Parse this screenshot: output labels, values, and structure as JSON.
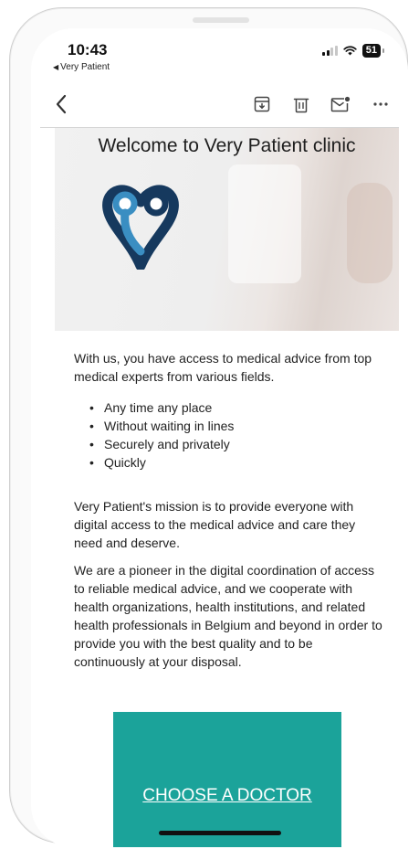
{
  "status_bar": {
    "time": "10:43",
    "back_app": "Very Patient",
    "battery": "51"
  },
  "toolbar": {
    "back": "chevron-left-icon",
    "archive": "archive-icon",
    "delete": "trash-icon",
    "mark_unread": "mail-icon",
    "more": "more-icon"
  },
  "email": {
    "hero_title": "Welcome to Very Patient clinic",
    "intro": "With us, you have access to medical advice from top medical experts from various fields.",
    "bullets": [
      "Any time any place",
      "Without waiting in lines",
      "Securely and privately",
      "Quickly"
    ],
    "mission": "Very Patient's mission is to provide everyone with digital access to the medical advice and care they need and deserve.",
    "pioneer": "We are a pioneer in the digital coordination of access to reliable medical advice, and we cooperate with health organizations, health institutions, and related health professionals in Belgium and beyond in order to provide you with the best quality and to be continuously at your disposal.",
    "cta_label": "CHOOSE A DOCTOR"
  },
  "colors": {
    "cta_background": "#1ba39a",
    "logo_light": "#3a8ec2",
    "logo_dark": "#16395e"
  }
}
